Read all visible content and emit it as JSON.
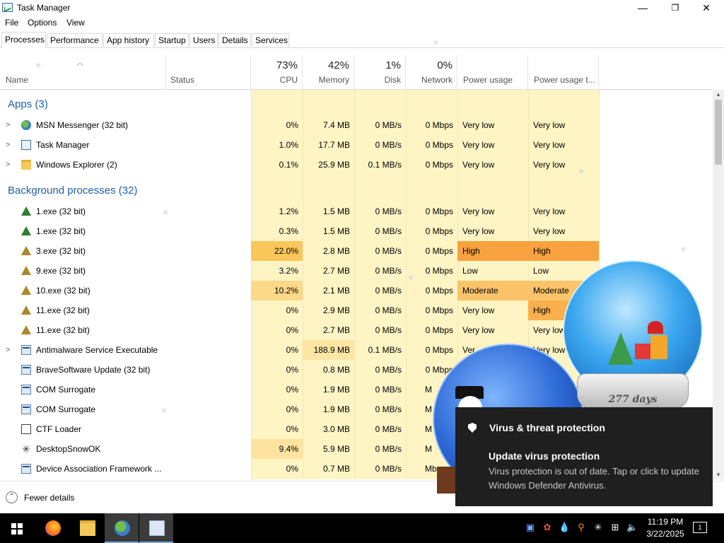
{
  "window": {
    "title": "Task Manager",
    "minimize": "—",
    "maximize": "❐",
    "close": "✕"
  },
  "menu": [
    "File",
    "Options",
    "View"
  ],
  "tabs": [
    "Processes",
    "Performance",
    "App history",
    "Startup",
    "Users",
    "Details",
    "Services"
  ],
  "columns": {
    "name": "Name",
    "status": "Status",
    "cpu_pct": "73%",
    "cpu": "CPU",
    "mem_pct": "42%",
    "mem": "Memory",
    "disk_pct": "1%",
    "disk": "Disk",
    "net_pct": "0%",
    "net": "Network",
    "power": "Power usage",
    "power_trend": "Power usage t..."
  },
  "groups": {
    "apps": "Apps (3)",
    "background": "Background processes (32)"
  },
  "apps": [
    {
      "name": "MSN Messenger (32 bit)",
      "cpu": "0%",
      "mem": "7.4 MB",
      "disk": "0 MB/s",
      "net": "0 Mbps",
      "power": "Very low",
      "trend": "Very low"
    },
    {
      "name": "Task Manager",
      "cpu": "1.0%",
      "mem": "17.7 MB",
      "disk": "0 MB/s",
      "net": "0 Mbps",
      "power": "Very low",
      "trend": "Very low"
    },
    {
      "name": "Windows Explorer (2)",
      "cpu": "0.1%",
      "mem": "25.9 MB",
      "disk": "0.1 MB/s",
      "net": "0 Mbps",
      "power": "Very low",
      "trend": "Very low"
    }
  ],
  "background": [
    {
      "name": "1.exe (32 bit)",
      "cpu": "1.2%",
      "mem": "1.5 MB",
      "disk": "0 MB/s",
      "net": "0 Mbps",
      "power": "Very low",
      "trend": "Very low"
    },
    {
      "name": "1.exe (32 bit)",
      "cpu": "0.3%",
      "mem": "1.5 MB",
      "disk": "0 MB/s",
      "net": "0 Mbps",
      "power": "Very low",
      "trend": "Very low"
    },
    {
      "name": "3.exe (32 bit)",
      "cpu": "22.0%",
      "mem": "2.8 MB",
      "disk": "0 MB/s",
      "net": "0 Mbps",
      "power": "High",
      "trend": "High"
    },
    {
      "name": "9.exe (32 bit)",
      "cpu": "3.2%",
      "mem": "2.7 MB",
      "disk": "0 MB/s",
      "net": "0 Mbps",
      "power": "Low",
      "trend": "Low"
    },
    {
      "name": "10.exe (32 bit)",
      "cpu": "10.2%",
      "mem": "2.1 MB",
      "disk": "0 MB/s",
      "net": "0 Mbps",
      "power": "Moderate",
      "trend": "Moderate"
    },
    {
      "name": "11.exe (32 bit)",
      "cpu": "0%",
      "mem": "2.9 MB",
      "disk": "0 MB/s",
      "net": "0 Mbps",
      "power": "Very low",
      "trend": "High"
    },
    {
      "name": "11.exe (32 bit)",
      "cpu": "0%",
      "mem": "2.7 MB",
      "disk": "0 MB/s",
      "net": "0 Mbps",
      "power": "Very low",
      "trend": "Very low"
    },
    {
      "name": "Antimalware Service Executable",
      "cpu": "0%",
      "mem": "188.9 MB",
      "disk": "0.1 MB/s",
      "net": "0 Mbps",
      "power": "Ver",
      "trend": "Very low"
    },
    {
      "name": "BraveSoftware Update (32 bit)",
      "cpu": "0%",
      "mem": "0.8 MB",
      "disk": "0 MB/s",
      "net": "0 Mbps",
      "power": "",
      "trend": ""
    },
    {
      "name": "COM Surrogate",
      "cpu": "0%",
      "mem": "1.9 MB",
      "disk": "0 MB/s",
      "net": "M",
      "power": "",
      "trend": ""
    },
    {
      "name": "COM Surrogate",
      "cpu": "0%",
      "mem": "1.9 MB",
      "disk": "0 MB/s",
      "net": "M",
      "power": "",
      "trend": ""
    },
    {
      "name": "CTF Loader",
      "cpu": "0%",
      "mem": "3.0 MB",
      "disk": "0 MB/s",
      "net": "M",
      "power": "",
      "trend": ""
    },
    {
      "name": "DesktopSnowOK",
      "cpu": "9.4%",
      "mem": "5.9 MB",
      "disk": "0 MB/s",
      "net": "M",
      "power": "",
      "trend": ""
    },
    {
      "name": "Device Association Framework ...",
      "cpu": "0%",
      "mem": "0.7 MB",
      "disk": "0 MB/s",
      "net": "Mb",
      "power": "",
      "trend": ""
    }
  ],
  "footer": {
    "fewer_details": "Fewer details",
    "chevron": "⌃"
  },
  "globe": {
    "days": "277 days"
  },
  "toast": {
    "title": "Virus & threat protection",
    "heading": "Update virus protection",
    "body": "Virus protection is out of date. Tap or click to update Windows Defender Antivirus."
  },
  "taskbar": {
    "time": "11:19 PM",
    "date": "3/22/2025",
    "notifications": "1"
  }
}
